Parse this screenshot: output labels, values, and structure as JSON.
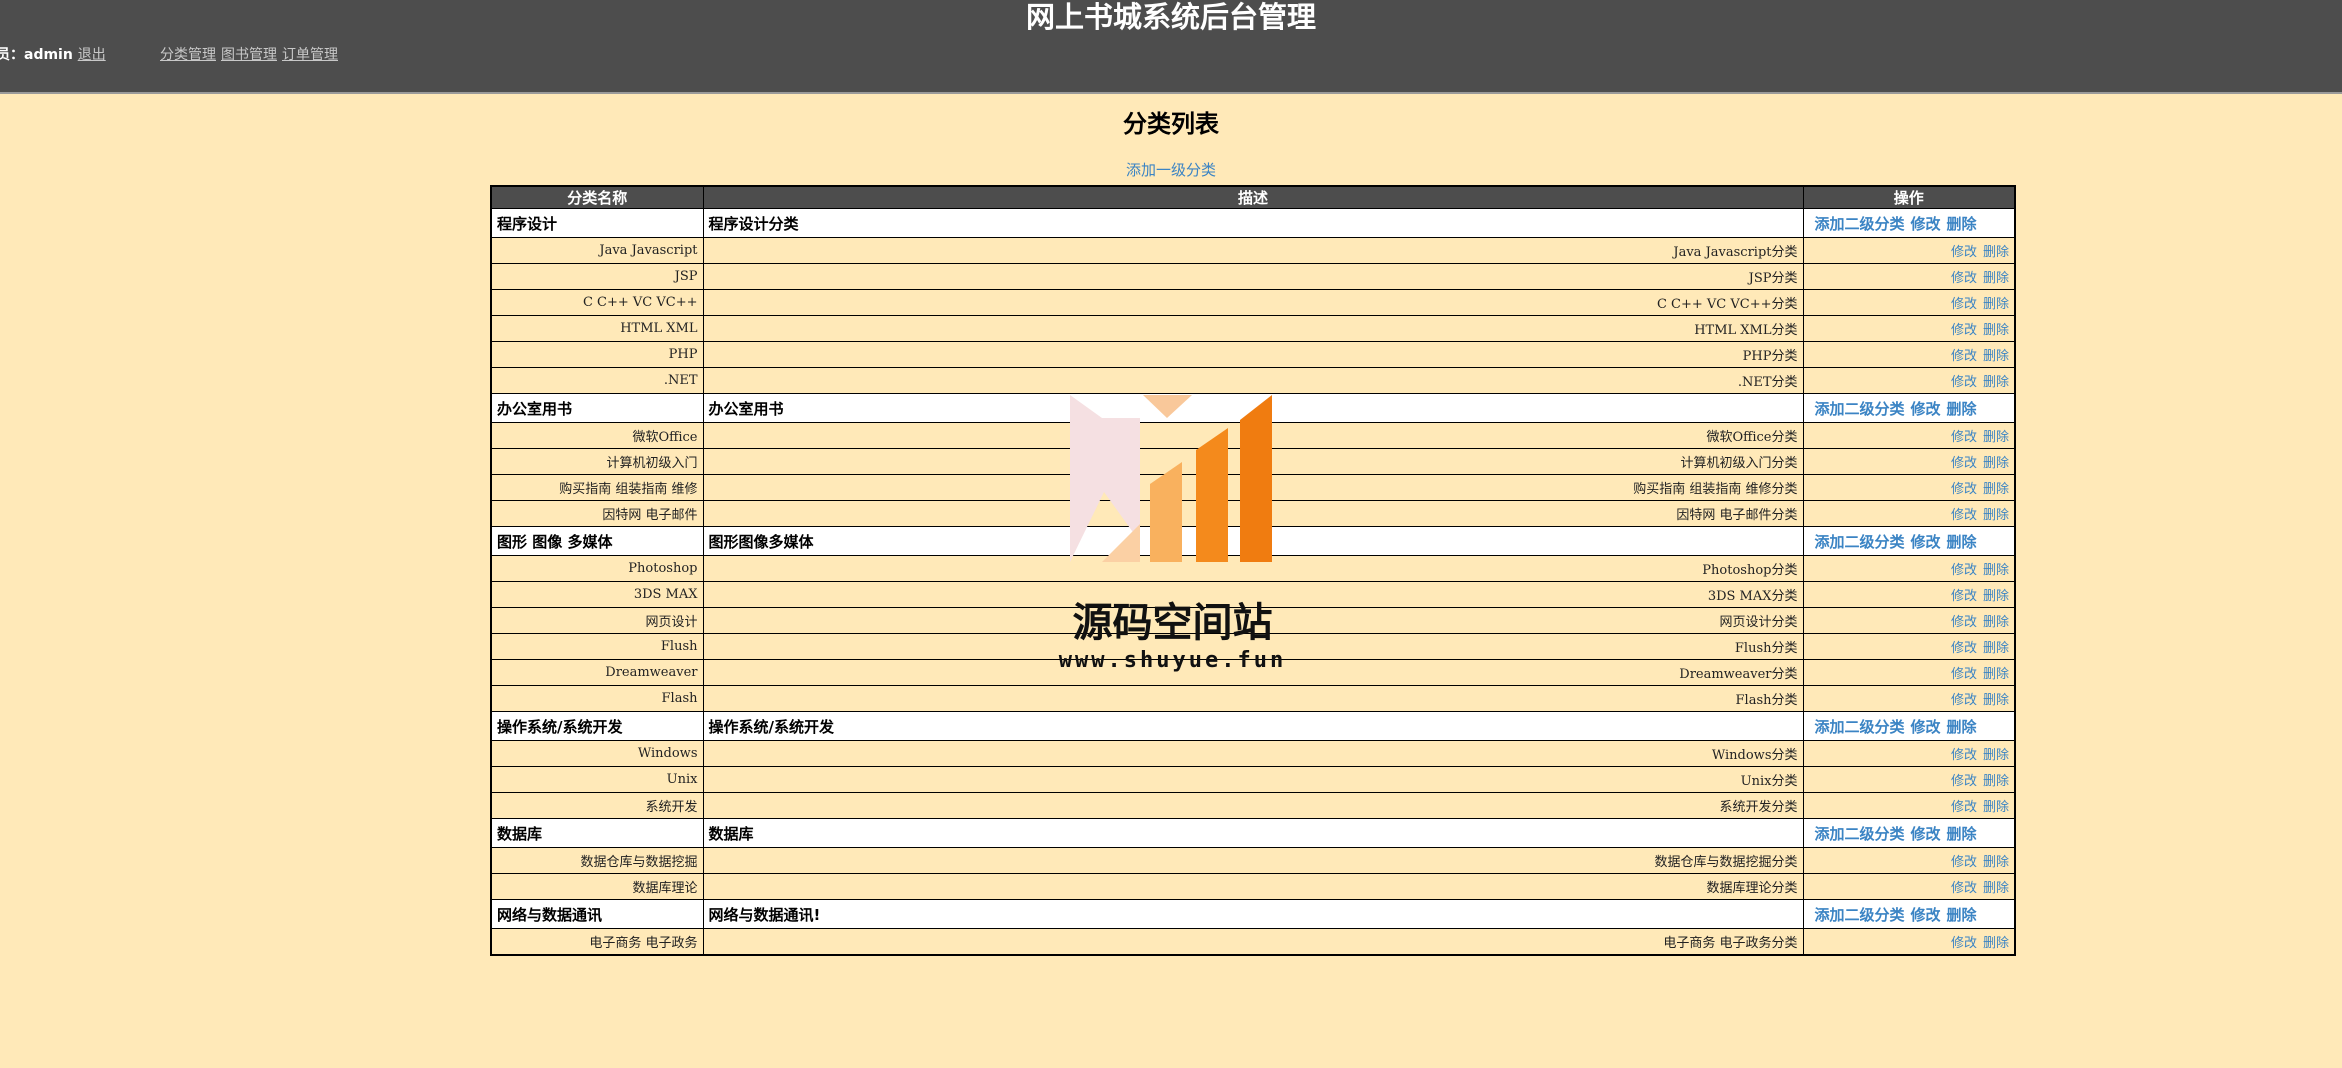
{
  "header": {
    "title": "网上书城系统后台管理",
    "admin_label": "理员：admin",
    "logout": "退出",
    "nav": [
      "分类管理",
      "图书管理",
      "订单管理"
    ]
  },
  "page_heading": "分类列表",
  "add_top_label": "添加一级分类",
  "table": {
    "columns": [
      "分类名称",
      "描述",
      "操作"
    ],
    "parent_ops": [
      "添加二级分类",
      "修改",
      "删除"
    ],
    "child_ops": [
      "修改",
      "删除"
    ],
    "groups": [
      {
        "name": "程序设计",
        "desc": "程序设计分类",
        "children": [
          {
            "name": "Java Javascript",
            "desc": "Java Javascript分类"
          },
          {
            "name": "JSP",
            "desc": "JSP分类"
          },
          {
            "name": "C C++ VC VC++",
            "desc": "C C++ VC VC++分类"
          },
          {
            "name": "HTML XML",
            "desc": "HTML XML分类"
          },
          {
            "name": "PHP",
            "desc": "PHP分类"
          },
          {
            "name": ".NET",
            "desc": ".NET分类"
          }
        ]
      },
      {
        "name": "办公室用书",
        "desc": "办公室用书",
        "children": [
          {
            "name": "微软Office",
            "desc": "微软Office分类"
          },
          {
            "name": "计算机初级入门",
            "desc": "计算机初级入门分类"
          },
          {
            "name": "购买指南 组装指南 维修",
            "desc": "购买指南 组装指南 维修分类"
          },
          {
            "name": "因特网 电子邮件",
            "desc": "因特网 电子邮件分类"
          }
        ]
      },
      {
        "name": "图形 图像 多媒体",
        "desc": "图形图像多媒体",
        "children": [
          {
            "name": "Photoshop",
            "desc": "Photoshop分类"
          },
          {
            "name": "3DS MAX",
            "desc": "3DS MAX分类"
          },
          {
            "name": "网页设计",
            "desc": "网页设计分类"
          },
          {
            "name": "Flush",
            "desc": "Flush分类"
          },
          {
            "name": "Dreamweaver",
            "desc": "Dreamweaver分类"
          },
          {
            "name": "Flash",
            "desc": "Flash分类"
          }
        ]
      },
      {
        "name": "操作系统/系统开发",
        "desc": "操作系统/系统开发",
        "children": [
          {
            "name": "Windows",
            "desc": "Windows分类"
          },
          {
            "name": "Unix",
            "desc": "Unix分类"
          },
          {
            "name": "系统开发",
            "desc": "系统开发分类"
          }
        ]
      },
      {
        "name": "数据库",
        "desc": "数据库",
        "children": [
          {
            "name": "数据仓库与数据挖掘",
            "desc": "数据仓库与数据挖掘分类"
          },
          {
            "name": "数据库理论",
            "desc": "数据库理论分类"
          }
        ]
      },
      {
        "name": "网络与数据通讯",
        "desc": "网络与数据通讯!",
        "children": [
          {
            "name": "电子商务 电子政务",
            "desc": "电子商务 电子政务分类"
          }
        ]
      }
    ]
  },
  "watermark": {
    "title": "源码空间站",
    "url": "www.shuyue.fun",
    "colors": {
      "pink": "#f5e0e2",
      "orange_light": "#f9b15e",
      "orange": "#f48a1c",
      "orange_dark": "#f07c10"
    }
  }
}
